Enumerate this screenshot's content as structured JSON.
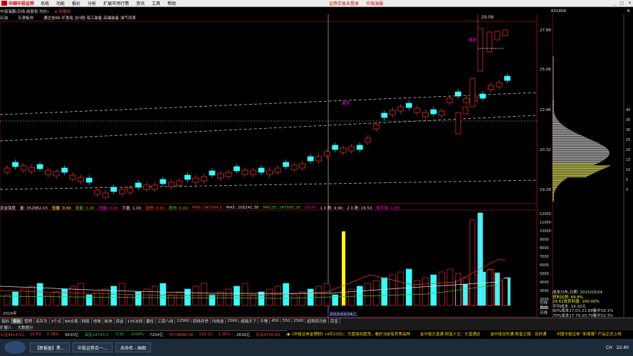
{
  "app": {
    "brand": "中国中投证券"
  },
  "menu": [
    "系统",
    "功能",
    "报价",
    "分析",
    "扩展市场行情",
    "资讯",
    "工具",
    "帮助"
  ],
  "center_links": [
    "证券交易未登录",
    "中海油服"
  ],
  "infobar": {
    "stock": "中海油服(日线 前复权 均价)",
    "tag": "⊕ 待盈利"
  },
  "topright": {
    "code": "601808"
  },
  "tagbar": [
    "石油",
    "天津板块",
    "通达信88 环渤海 含H股 海工装备 高端装备 油气改革"
  ],
  "price_chart": {
    "high_label": "29.08",
    "annotation_buy": "离场",
    "annotation_buy2": "离场",
    "ticks": [
      "27.88",
      "25.06",
      "22.96",
      "20.32",
      "19.28"
    ],
    "right_nums": [
      "40",
      "35",
      "30",
      "25",
      "20",
      "15",
      "10",
      "5",
      "0"
    ],
    "date_label": "2015/03/24/二"
  },
  "volinfo": [
    {
      "t": "资金强度",
      "c": "#ddd"
    },
    {
      "t": "量: 352882.03",
      "c": "#ddd"
    },
    {
      "t": "倍量: 0.00",
      "c": "#ff4"
    },
    {
      "t": "缩量: 0.00",
      "c": "#3c3"
    },
    {
      "t": "地量: 0.00",
      "c": "#f0f"
    },
    {
      "t": "平量: 1.00",
      "c": "#ddd"
    },
    {
      "t": "涨停: 0.00",
      "c": "#f44"
    },
    {
      "t": "跌停: 0.00",
      "c": "#3c3"
    },
    {
      "t": "MA5: 347004.6",
      "c": "#f44"
    },
    {
      "t": "MA5: 208241.38",
      "c": "#ddd"
    },
    {
      "t": "MA135: 245580.28",
      "c": "#3c3"
    },
    {
      "t": "10.00",
      "c": "#f0f"
    },
    {
      "t": "1 0 跌: 9.90",
      "c": "#ddd"
    },
    {
      "t": "2 0 跌: 16.53",
      "c": "#ddd"
    },
    {
      "t": "换手率: 1.18",
      "c": "#f0f"
    }
  ],
  "vol_ticks": [
    "12000",
    "11000",
    "10000",
    "9000",
    "8000",
    "7000",
    "6000",
    "5000",
    "4000",
    "3000",
    "2000",
    "1000"
  ],
  "vol_xtick": "2016年",
  "stats": [
    "成本分布,日期: 2015/03/24",
    "获利比例: 69.8%",
    "29.61处获利盘: 100.00%",
    "平均成本: 19.20元",
    "90%成本17.01-21.69集中16.1%",
    "70%成本17.79-20.79集中10.3%"
  ],
  "bottom_tabs": [
    "指标",
    "模板",
    "管理",
    "另存为",
    "3个点",
    "BA交易",
    "网络",
    "地域",
    "板块",
    "资金",
    "135法则",
    "量柱",
    "江恩八线",
    "12560",
    "四线并举",
    "均线选",
    "2560",
    "超级天下",
    "牛警",
    "450",
    "550",
    "2560",
    "趋势回马枪",
    "百宝"
  ],
  "right_side_tabs": [
    "日线",
    "周线",
    "月线"
  ],
  "sub_tabs": [
    "扩展八",
    "大数据分"
  ],
  "ticker": [
    {
      "t": "上证4414.51",
      "c": "up"
    },
    {
      "t": "16.83",
      "c": "up"
    },
    {
      "t": "0.38%",
      "c": "up"
    },
    {
      "t": "9630亿",
      "c": ""
    },
    {
      "t": "深证14743.2",
      "c": "dn"
    },
    {
      "t": "-5.91",
      "c": "dn"
    },
    {
      "t": "-0.04%",
      "c": "dn"
    },
    {
      "t": "7204亿",
      "c": ""
    },
    {
      "t": "中小8886.08",
      "c": "up"
    },
    {
      "t": "110.15",
      "c": "up"
    },
    {
      "t": "1.26%",
      "c": "up"
    },
    {
      "t": "2636亿",
      "c": ""
    },
    {
      "t": "沪深4740.89",
      "c": "up"
    },
    {
      "t": "创业2706.19",
      "c": "up"
    },
    {
      "t": "21.26",
      "c": "up"
    },
    {
      "t": "0.79%",
      "c": "up"
    },
    {
      "t": "1253亿",
      "c": ""
    }
  ],
  "news": [
    "◆《中投证券金理财》(4月23日)：大盘强劲震荡，看好当前有色等品种",
    "金中投久富通-财富人生：久富通达",
    "金中投及时通-财富之路：及时通",
    "中国中投证券 \"新易顺\" 产品正式上线"
  ],
  "taskbar": [
    "【新报盈】黑…",
    "中投证券合一…",
    "未命名 - 画图"
  ],
  "tray": [
    "CH",
    "22:40"
  ]
}
